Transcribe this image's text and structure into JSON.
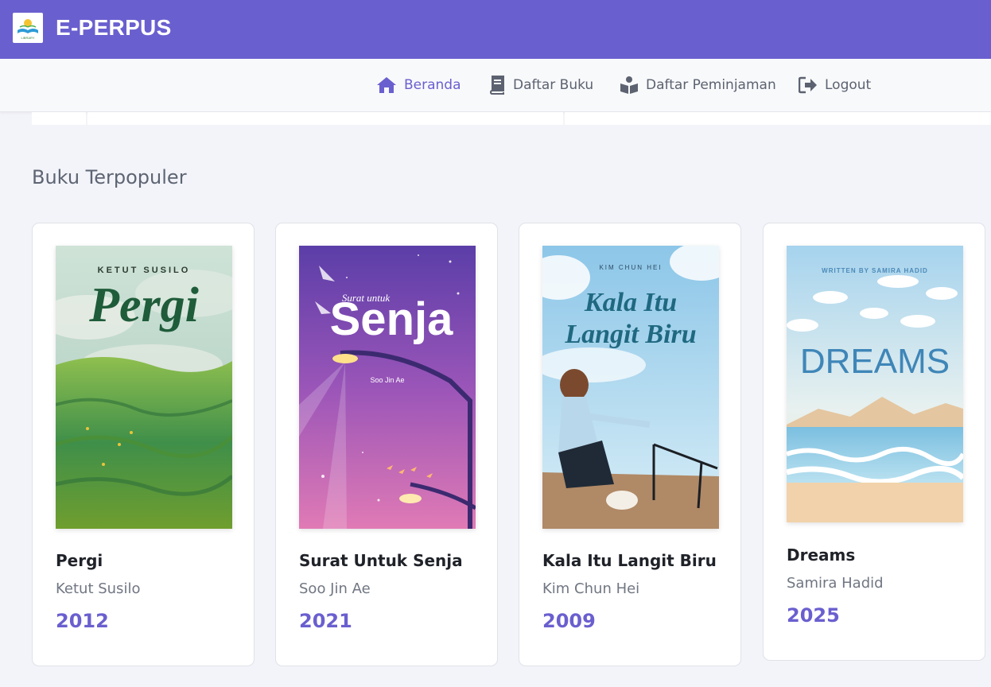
{
  "header": {
    "brand": "E-PERPUS",
    "logo_text": "LIBRARY"
  },
  "nav": {
    "items": [
      {
        "label": "Beranda",
        "icon": "home-icon",
        "active": true
      },
      {
        "label": "Daftar Buku",
        "icon": "book-icon",
        "active": false
      },
      {
        "label": "Daftar Peminjaman",
        "icon": "book-reader-icon",
        "active": false
      },
      {
        "label": "Logout",
        "icon": "logout-icon",
        "active": false
      }
    ]
  },
  "section": {
    "title": "Buku Terpopuler"
  },
  "books": [
    {
      "title": "Pergi",
      "author": "Ketut Susilo",
      "year": "2012",
      "cover": {
        "author_text": "KETUT SUSILO",
        "title_text": "Pergi"
      }
    },
    {
      "title": "Surat Untuk Senja",
      "author": "Soo Jin Ae",
      "year": "2021",
      "cover": {
        "pre_text": "Surat untuk",
        "title_text": "Senja",
        "author_text": "Soo Jin Ae"
      }
    },
    {
      "title": "Kala Itu Langit Biru",
      "author": "Kim Chun Hei",
      "year": "2009",
      "cover": {
        "author_text": "KIM CHUN HEI",
        "title_line1": "Kala Itu",
        "title_line2": "Langit Biru"
      }
    },
    {
      "title": "Dreams",
      "author": "Samira Hadid",
      "year": "2025",
      "cover": {
        "author_text": "WRITTEN BY SAMIRA HADID",
        "title_text": "DREAMS"
      }
    }
  ],
  "colors": {
    "accent": "#6a5fcf",
    "background": "#f3f4f9"
  }
}
